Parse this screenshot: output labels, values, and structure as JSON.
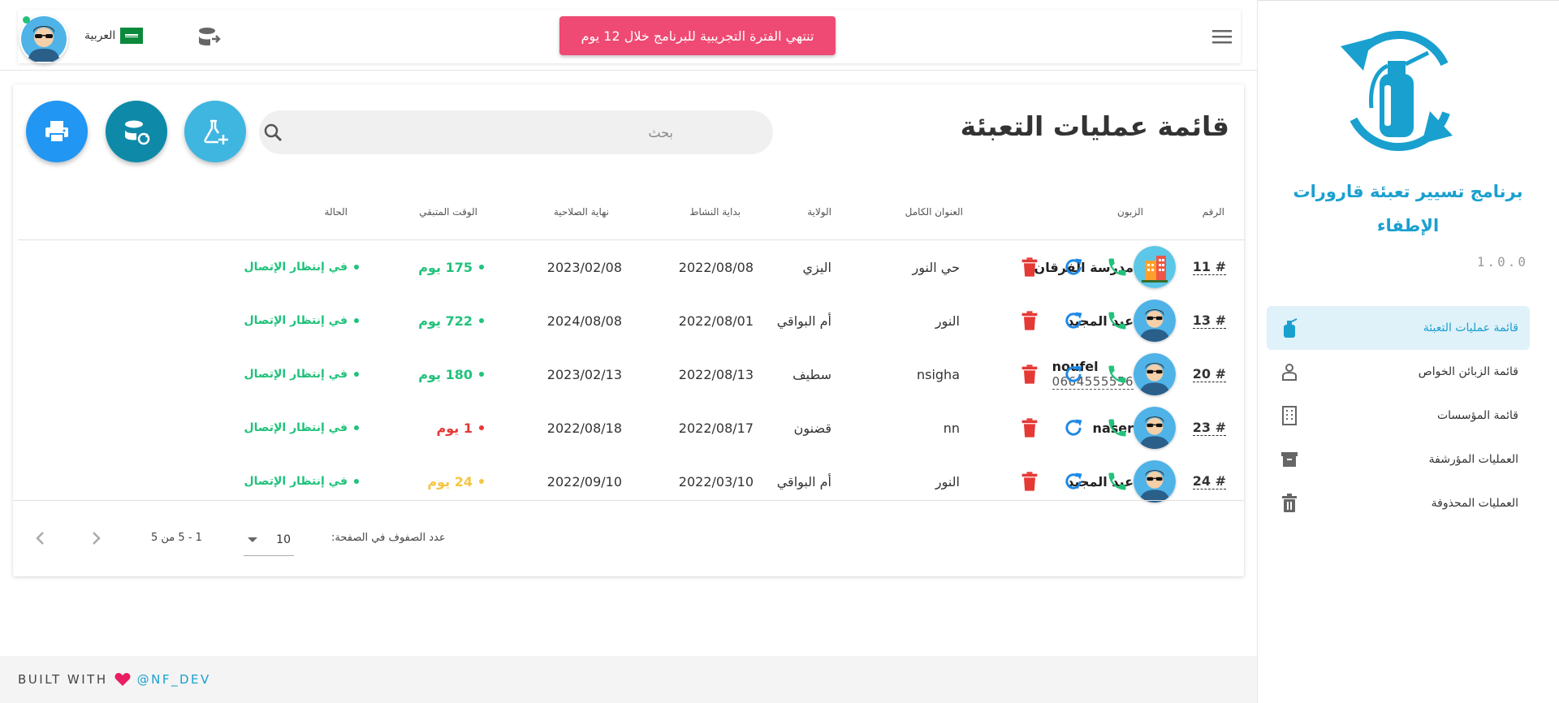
{
  "sidebar": {
    "app_title": "برنامج تسيير تعبئة قارورات الإطفاء",
    "version": "1.0.0",
    "items": [
      {
        "label": "قائمة عمليات التعبئة",
        "icon": "fire-extinguisher-icon",
        "active": true
      },
      {
        "label": "قائمة الزبائن الخواص",
        "icon": "person-icon",
        "active": false
      },
      {
        "label": "قائمة المؤسسات",
        "icon": "building-icon",
        "active": false
      },
      {
        "label": "العمليات المؤرشفة",
        "icon": "archive-icon",
        "active": false
      },
      {
        "label": "العمليات المحذوفة",
        "icon": "trash-icon",
        "active": false
      }
    ]
  },
  "topbar": {
    "language": "العربية",
    "trial_banner": "تنتهي الفترة التجريبية للبرنامج خلال 12 يوم"
  },
  "main": {
    "title": "قائمة عمليات التعبئة",
    "search_placeholder": "بحث",
    "columns": {
      "number": "الرقم",
      "client": "الزبون",
      "address": "العنوان الكامل",
      "wilaya": "الولاية",
      "start": "بداية النشاط",
      "end": "نهاية الصلاحية",
      "remaining": "الوقت المتبقي",
      "status": "الحالة"
    },
    "rows": [
      {
        "number": "# 11",
        "client": "مدرسة الفرقان",
        "phone": "",
        "avatar": "building",
        "address": "حي النور",
        "wilaya": "اليزي",
        "start": "2022/08/08",
        "end": "2023/02/08",
        "remaining": "175 يوم",
        "remaining_color": "#21c27b",
        "status": "في إنتظار الإتصال"
      },
      {
        "number": "# 13",
        "client": "عبد المجيد",
        "phone": "",
        "avatar": "person",
        "address": "النور",
        "wilaya": "أم البواقي",
        "start": "2022/08/01",
        "end": "2024/08/08",
        "remaining": "722 يوم",
        "remaining_color": "#21c27b",
        "status": "في إنتظار الإتصال"
      },
      {
        "number": "# 20",
        "client": "noufel",
        "phone": "0664555556",
        "avatar": "person",
        "address": "nsigha",
        "wilaya": "سطيف",
        "start": "2022/08/13",
        "end": "2023/02/13",
        "remaining": "180 يوم",
        "remaining_color": "#21c27b",
        "status": "في إنتظار الإتصال"
      },
      {
        "number": "# 23",
        "client": "naser",
        "phone": "",
        "avatar": "person",
        "address": "nn",
        "wilaya": "قضنون",
        "start": "2022/08/17",
        "end": "2022/08/18",
        "remaining": "1 يوم",
        "remaining_color": "#e53935",
        "status": "في إنتظار الإتصال"
      },
      {
        "number": "# 24",
        "client": "عبد المجيد",
        "phone": "",
        "avatar": "person",
        "address": "النور",
        "wilaya": "أم البواقي",
        "start": "2022/03/10",
        "end": "2022/09/10",
        "remaining": "24 يوم",
        "remaining_color": "#f5c542",
        "status": "في إنتظار الإتصال"
      }
    ],
    "pagination": {
      "rows_per_page_label": "عدد الصفوف في الصفحة:",
      "rows_per_page": "10",
      "range": "1 - 5 من 5"
    }
  },
  "footer": {
    "built_with": "BUILT WITH",
    "handle": "@NF_DEV"
  },
  "colors": {
    "brand": "#1aa0cf",
    "banner": "#ef4a73",
    "status_green": "#21c27b",
    "delete_red": "#e53935",
    "refresh_blue": "#1e88e5"
  }
}
